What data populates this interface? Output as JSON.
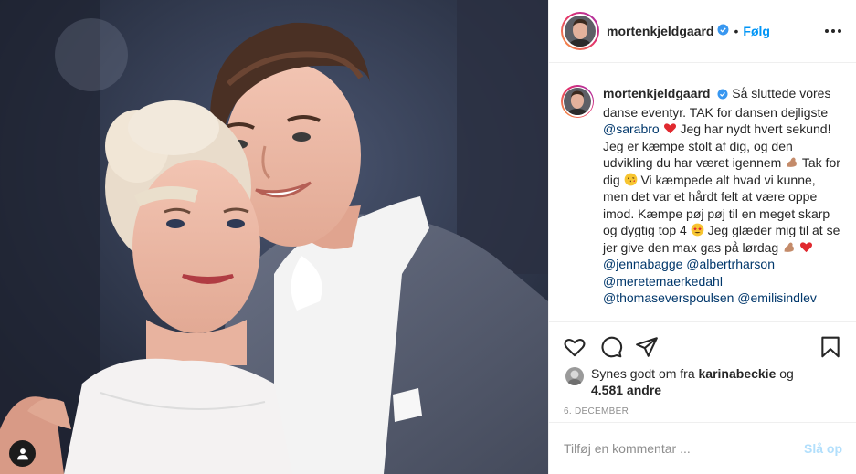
{
  "post": {
    "username": "mortenkjeldgaard",
    "follow_label": "Følg",
    "dot": "•",
    "caption": {
      "text_1": "Så sluttede vores danse eventyr. TAK for dansen dejligste",
      "mention_1": "@sarabro",
      "text_2": "Jeg har nydt hvert sekund! Jeg er kæmpe stolt af dig, og den udvikling du har været igennem",
      "text_3": "Tak for dig",
      "text_4": "Vi kæmpede alt hvad vi kunne, men det var et hårdt felt at være oppe imod. Kæmpe pøj pøj til en meget skarp og dygtig top 4",
      "text_5": "Jeg glæder mig til at se jer give den max gas på lørdag",
      "mention_2": "@jennabagge",
      "mention_3": "@albertrharson",
      "mention_4": "@meretemaerkedahl",
      "mention_5": "@thomaseverspoulsen",
      "mention_6": "@emilisindlev"
    },
    "likes": {
      "prefix": "Synes godt om fra",
      "liker": "karinabeckie",
      "connector": "og",
      "others": "4.581 andre"
    },
    "date": "6. DECEMBER",
    "comment_placeholder": "Tilføj en kommentar ...",
    "post_label": "Slå op"
  },
  "icons": {
    "verified": "verified-badge-icon",
    "more": "more-options-icon",
    "like": "heart-outline-icon",
    "comment": "comment-bubble-icon",
    "share": "paper-plane-icon",
    "save": "bookmark-icon",
    "tag": "user-tag-icon"
  },
  "colors": {
    "accent": "#0095f6",
    "mention": "#00376b",
    "post_disabled": "#b2dffc",
    "muted": "#8e8e8e",
    "border": "#efefef"
  }
}
